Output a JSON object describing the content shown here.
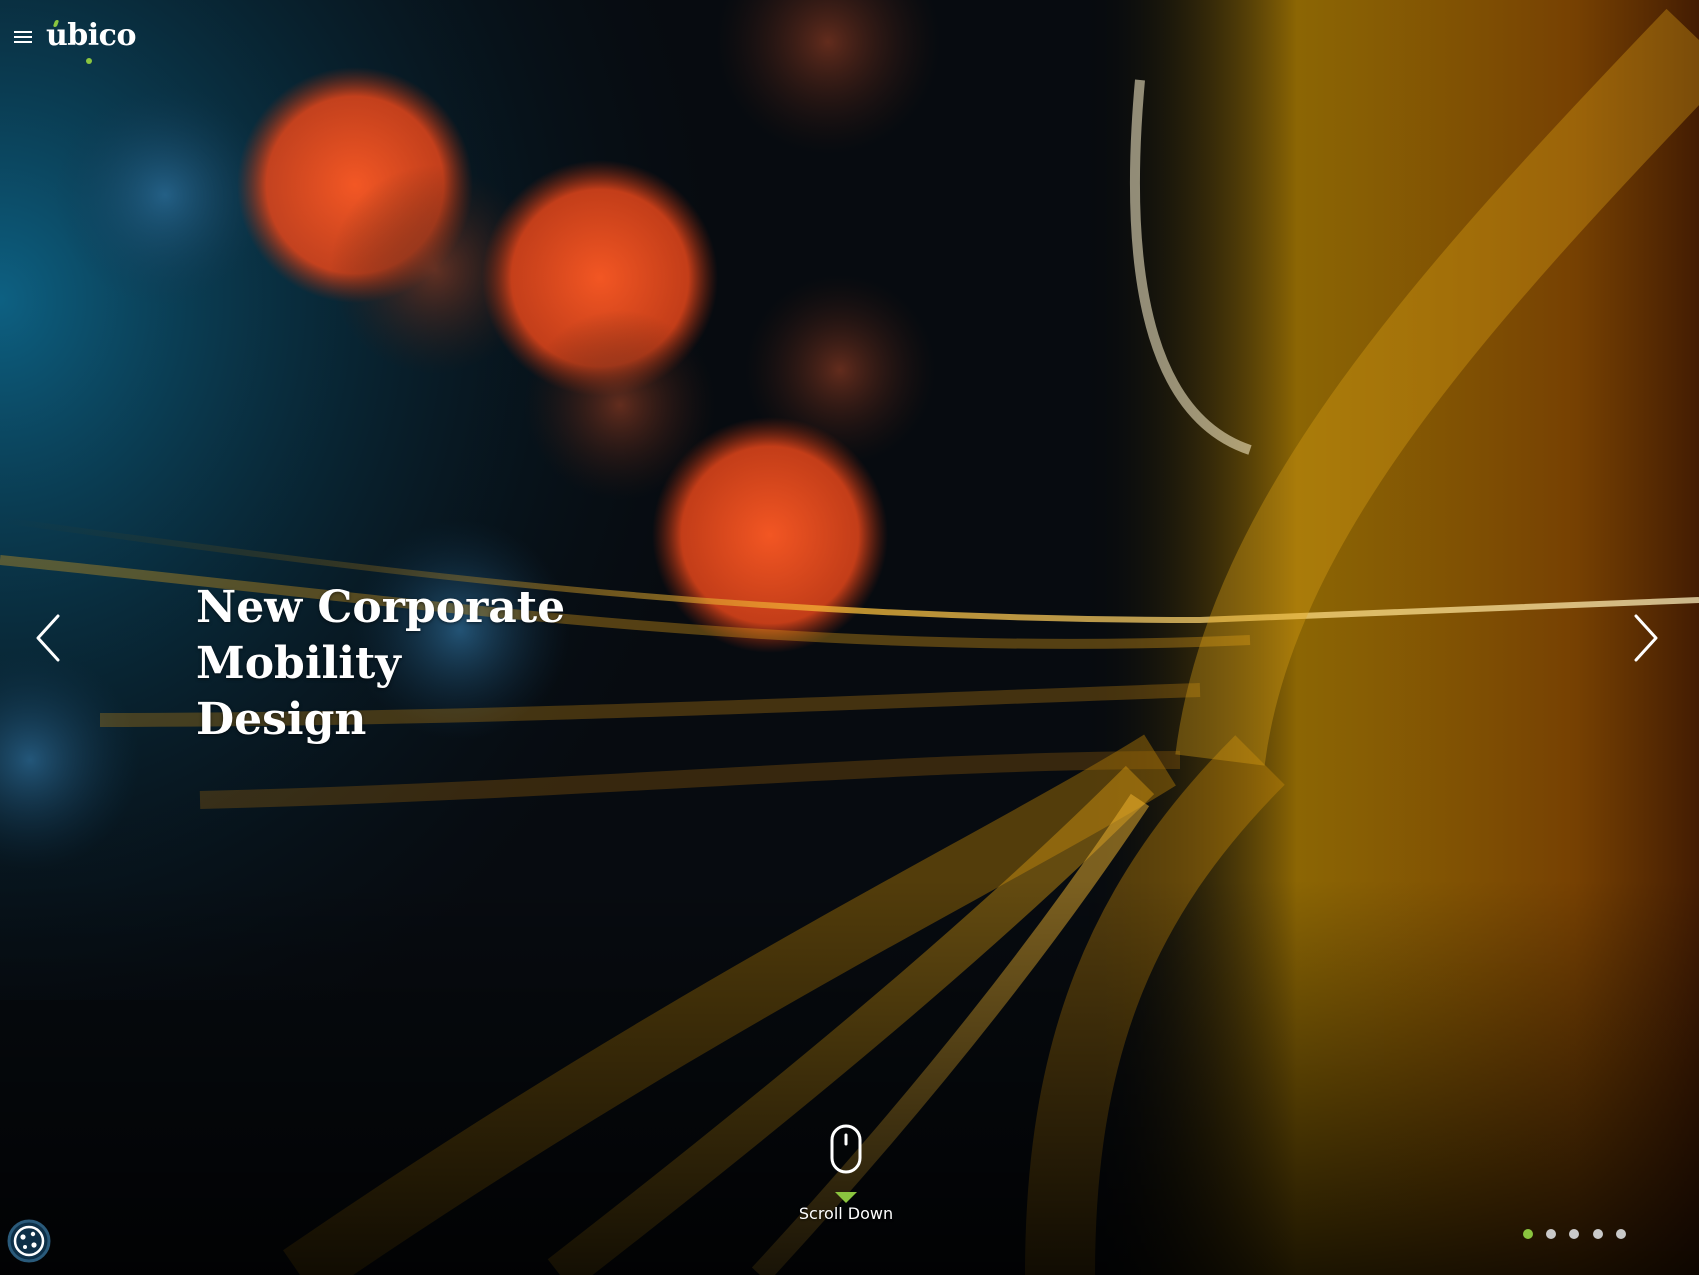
{
  "header": {
    "menu_icon": "hamburger-menu-icon",
    "logo_text": "ubico"
  },
  "hero": {
    "title_line_1": "New Corporate Mobility",
    "title_line_2": "Design",
    "prev_icon": "chevron-left-icon",
    "next_icon": "chevron-right-icon",
    "scroll_icon": "mouse-icon",
    "scroll_label": "Scroll Down"
  },
  "slider": {
    "slide_count": 5,
    "active_slide": 1
  },
  "cookie_settings": {
    "icon": "cookie-icon"
  },
  "colors": {
    "accent": "#8bc53f",
    "text": "#ffffff",
    "dot_inactive": "#c9c9c9",
    "cookie_ring": "#2a5a7a"
  }
}
